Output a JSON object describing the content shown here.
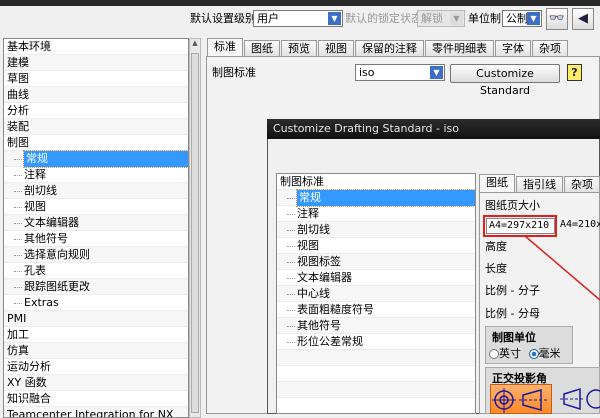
{
  "toolbar": {
    "level_label": "默认设置级别",
    "level_value": "用户",
    "lock_label": "默认的锁定状态",
    "lock_value": "解锁",
    "unit_label": "单位制",
    "unit_value": "公制"
  },
  "sidebar": {
    "items": [
      {
        "label": "基本环境"
      },
      {
        "label": "建模"
      },
      {
        "label": "草图"
      },
      {
        "label": "曲线"
      },
      {
        "label": "分析"
      },
      {
        "label": "装配"
      },
      {
        "label": "制图"
      },
      {
        "label": "常规",
        "child": true,
        "selected": true
      },
      {
        "label": "注释",
        "child": true
      },
      {
        "label": "剖切线",
        "child": true
      },
      {
        "label": "视图",
        "child": true
      },
      {
        "label": "文本编辑器",
        "child": true
      },
      {
        "label": "其他符号",
        "child": true
      },
      {
        "label": "选择意向规则",
        "child": true
      },
      {
        "label": "孔表",
        "child": true
      },
      {
        "label": "跟踪图纸更改",
        "child": true
      },
      {
        "label": "Extras",
        "child": true
      },
      {
        "label": "PMI"
      },
      {
        "label": "加工"
      },
      {
        "label": "仿真"
      },
      {
        "label": "运动分析"
      },
      {
        "label": "XY 函数"
      },
      {
        "label": "知识融合"
      },
      {
        "label": "Teamcenter Integration for NX"
      }
    ]
  },
  "main": {
    "tabs": [
      "标准",
      "图纸",
      "预览",
      "视图",
      "保留的注释",
      "零件明细表",
      "字体",
      "杂项"
    ],
    "standard_label": "制图标准",
    "standard_value": "iso",
    "customize_button": "Customize Standard",
    "help": "?"
  },
  "dialog": {
    "title": "Customize Drafting Standard - iso",
    "tree_root": "制图标准",
    "tree_items": [
      "常规",
      "注释",
      "剖切线",
      "视图",
      "视图标签",
      "文本编辑器",
      "中心线",
      "表面粗糙度符号",
      "其他符号",
      "形位公差常规"
    ],
    "tabs": [
      "图纸",
      "指引线",
      "杂项"
    ],
    "sheet_size_label": "图纸页大小",
    "sheet_size_1": "A4=297x210",
    "sheet_size_2": "A4=210x",
    "height_label": "高度",
    "length_label": "长度",
    "scale_num_label": "比例 - 分子",
    "scale_den_label": "比例 - 分母",
    "units_group": "制图单位",
    "unit_inch": "英寸",
    "unit_mm": "毫米",
    "projection_group": "正交投影角"
  },
  "colors": {
    "selection": "#3399ff",
    "highlight": "#e02020",
    "projection_active": "#ff8a2a"
  }
}
